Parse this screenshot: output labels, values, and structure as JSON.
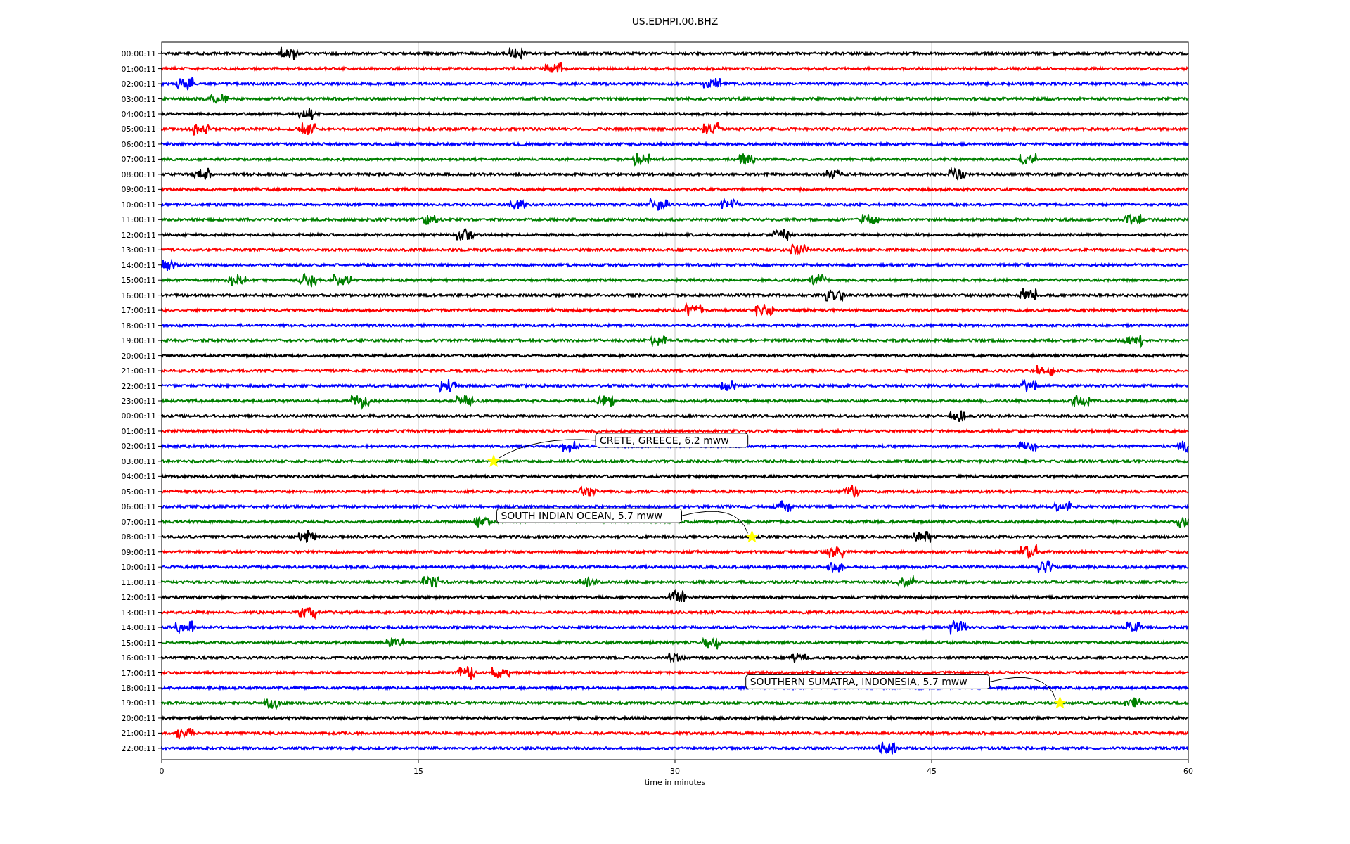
{
  "plot": {
    "title": "US.EDHPI.00.BHZ",
    "x_axis_label": "time in minutes",
    "x_tick_labels": [
      "0",
      "15",
      "30",
      "45",
      "60"
    ],
    "rows": [
      {
        "label": "00:00:11",
        "color": "#000000"
      },
      {
        "label": "01:00:11",
        "color": "#ff0000"
      },
      {
        "label": "02:00:11",
        "color": "#0000ff"
      },
      {
        "label": "03:00:11",
        "color": "#008000"
      },
      {
        "label": "04:00:11",
        "color": "#000000"
      },
      {
        "label": "05:00:11",
        "color": "#ff0000"
      },
      {
        "label": "06:00:11",
        "color": "#0000ff"
      },
      {
        "label": "07:00:11",
        "color": "#008000"
      },
      {
        "label": "08:00:11",
        "color": "#000000"
      },
      {
        "label": "09:00:11",
        "color": "#ff0000"
      },
      {
        "label": "10:00:11",
        "color": "#0000ff"
      },
      {
        "label": "11:00:11",
        "color": "#008000"
      },
      {
        "label": "12:00:11",
        "color": "#000000"
      },
      {
        "label": "13:00:11",
        "color": "#ff0000"
      },
      {
        "label": "14:00:11",
        "color": "#0000ff"
      },
      {
        "label": "15:00:11",
        "color": "#008000"
      },
      {
        "label": "16:00:11",
        "color": "#000000"
      },
      {
        "label": "17:00:11",
        "color": "#ff0000"
      },
      {
        "label": "18:00:11",
        "color": "#0000ff"
      },
      {
        "label": "19:00:11",
        "color": "#008000"
      },
      {
        "label": "20:00:11",
        "color": "#000000"
      },
      {
        "label": "21:00:11",
        "color": "#ff0000"
      },
      {
        "label": "22:00:11",
        "color": "#0000ff"
      },
      {
        "label": "23:00:11",
        "color": "#008000"
      },
      {
        "label": "00:00:11",
        "color": "#000000"
      },
      {
        "label": "01:00:11",
        "color": "#ff0000"
      },
      {
        "label": "02:00:11",
        "color": "#0000ff"
      },
      {
        "label": "03:00:11",
        "color": "#008000",
        "event": {
          "text": "CRETE, GREECE, 6.2 mww"
        }
      },
      {
        "label": "04:00:11",
        "color": "#000000"
      },
      {
        "label": "05:00:11",
        "color": "#ff0000"
      },
      {
        "label": "06:00:11",
        "color": "#0000ff"
      },
      {
        "label": "07:00:11",
        "color": "#008000"
      },
      {
        "label": "08:00:11",
        "color": "#000000",
        "event": {
          "text": "SOUTH INDIAN OCEAN, 5.7 mww"
        }
      },
      {
        "label": "09:00:11",
        "color": "#ff0000"
      },
      {
        "label": "10:00:11",
        "color": "#0000ff"
      },
      {
        "label": "11:00:11",
        "color": "#008000"
      },
      {
        "label": "12:00:11",
        "color": "#000000"
      },
      {
        "label": "13:00:11",
        "color": "#ff0000"
      },
      {
        "label": "14:00:11",
        "color": "#0000ff"
      },
      {
        "label": "15:00:11",
        "color": "#008000"
      },
      {
        "label": "16:00:11",
        "color": "#000000"
      },
      {
        "label": "17:00:11",
        "color": "#ff0000"
      },
      {
        "label": "18:00:11",
        "color": "#0000ff"
      },
      {
        "label": "19:00:11",
        "color": "#008000",
        "event": {
          "text": "SOUTHERN SUMATRA, INDONESIA, 5.7 mww"
        }
      },
      {
        "label": "20:00:11",
        "color": "#000000"
      },
      {
        "label": "21:00:11",
        "color": "#ff0000"
      },
      {
        "label": "22:00:11",
        "color": "#0000ff"
      }
    ]
  }
}
